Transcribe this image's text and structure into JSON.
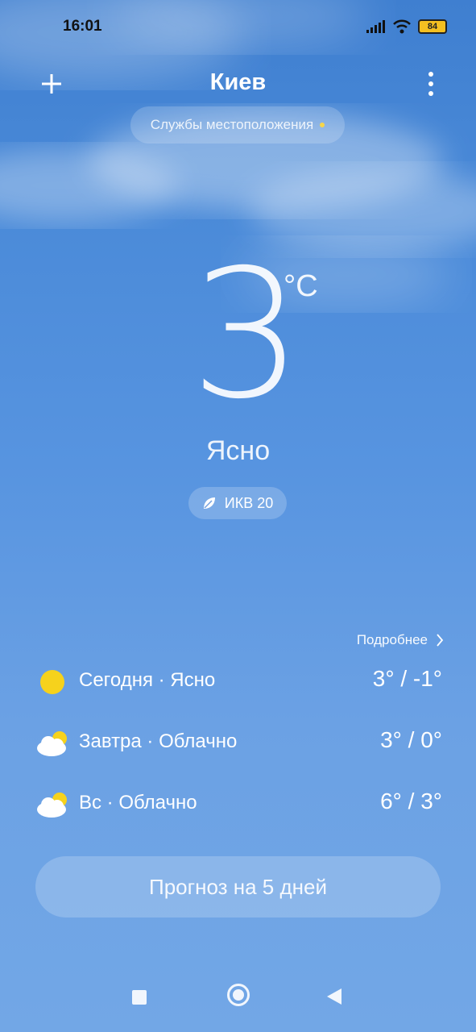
{
  "status_bar": {
    "time": "16:01",
    "battery": "84"
  },
  "header": {
    "city": "Киев"
  },
  "location_services": {
    "label": "Службы местоположения"
  },
  "current": {
    "temperature": "3",
    "unit": "°C",
    "condition": "Ясно",
    "aqi_label": "ИКВ 20"
  },
  "forecast": {
    "more_label": "Подробнее",
    "rows": [
      {
        "label": "Сегодня · Ясно",
        "range": "3° / -1°",
        "icon": "sun-icon"
      },
      {
        "label": "Завтра · Облачно",
        "range": "3° / 0°",
        "icon": "cloudy-icon"
      },
      {
        "label": "Вс · Облачно",
        "range": "6° / 3°",
        "icon": "cloudy-icon"
      }
    ]
  },
  "button": {
    "five_day": "Прогноз на 5 дней"
  }
}
